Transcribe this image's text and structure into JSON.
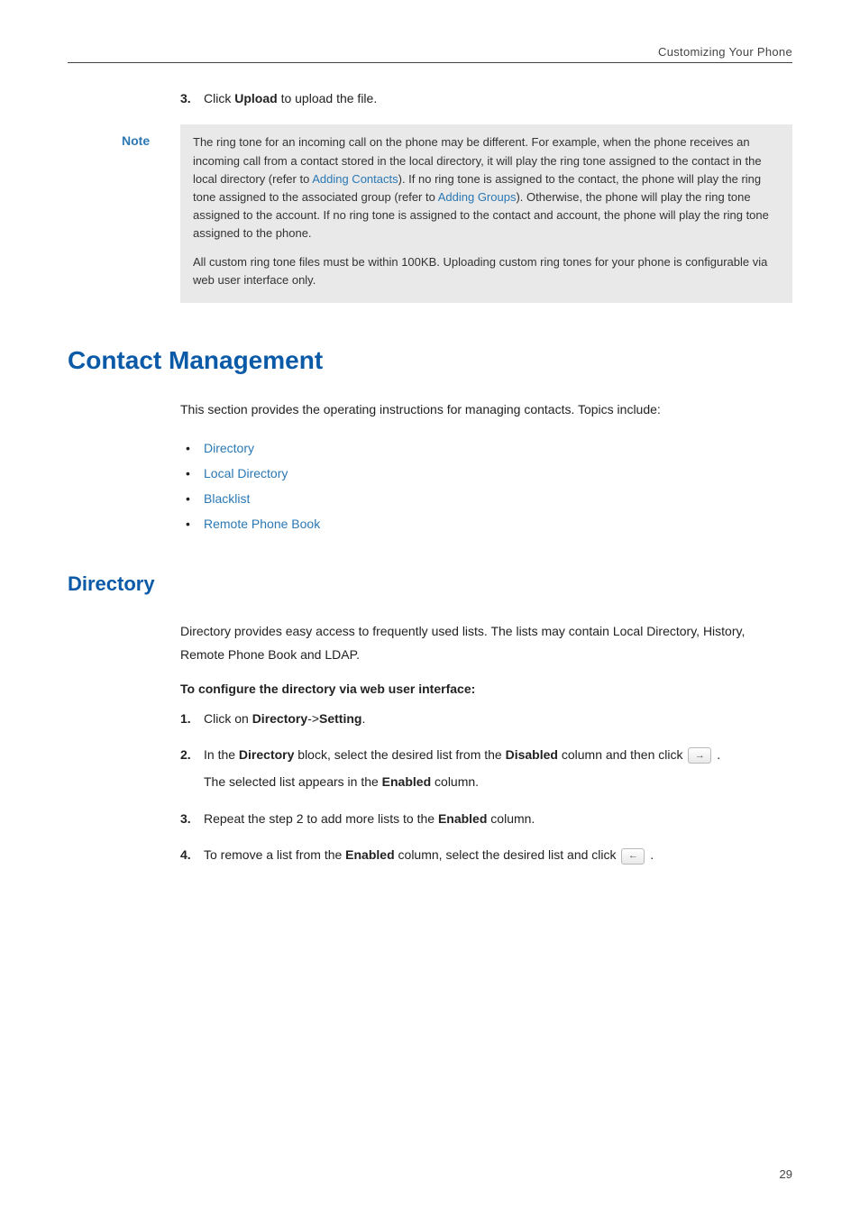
{
  "header": {
    "breadcrumb": "Customizing Your Phone"
  },
  "step_upload": {
    "num": "3.",
    "prefix": "Click ",
    "bold": "Upload",
    "suffix": " to upload the file."
  },
  "note": {
    "label": "Note",
    "p1a": "The ring tone for an incoming call on the phone may be different. For example, when the phone receives an incoming call from a contact stored in the local directory, it will play the ring tone assigned to the contact in the local directory (refer to ",
    "p1link1": "Adding Contacts",
    "p1b": "). If no ring tone is assigned to the contact, the phone will play the ring tone assigned to the associated group (refer to ",
    "p1link2": "Adding Groups",
    "p1c": "). Otherwise, the phone will play the ring tone assigned to the account. If no ring tone is assigned to the contact and account, the phone will play the ring tone assigned to the phone.",
    "p2": "All custom ring tone files must be within 100KB. Uploading custom ring tones for your phone is configurable via web user interface only."
  },
  "section": {
    "title": "Contact Management",
    "intro": "This section provides the operating instructions for managing contacts. Topics include:",
    "bullets": [
      "Directory",
      "Local Directory",
      "Blacklist",
      "Remote Phone Book"
    ]
  },
  "directory": {
    "title": "Directory",
    "para": "Directory provides easy access to frequently used lists. The lists may contain Local Directory, History, Remote Phone Book and LDAP.",
    "subhead": "To configure the directory via web user interface:",
    "steps": {
      "s1": {
        "num": "1.",
        "a": "Click on ",
        "b1": "Directory",
        "mid": "->",
        "b2": "Setting",
        "end": "."
      },
      "s2": {
        "num": "2.",
        "a": "In the ",
        "b1": "Directory",
        "b": " block, select the desired list from the ",
        "b2": "Disabled",
        "c": " column and then click ",
        "arrow": "→",
        "d": " .",
        "line2a": "The selected list appears in the ",
        "line2b": "Enabled",
        "line2c": " column."
      },
      "s3": {
        "num": "3.",
        "a": "Repeat the step 2 to add more lists to the ",
        "b": "Enabled",
        "c": " column."
      },
      "s4": {
        "num": "4.",
        "a": "To remove a list from the ",
        "b": "Enabled",
        "c": " column, select the desired list and click ",
        "arrow": "←",
        "d": " ."
      }
    }
  },
  "footer": {
    "page": "29"
  }
}
